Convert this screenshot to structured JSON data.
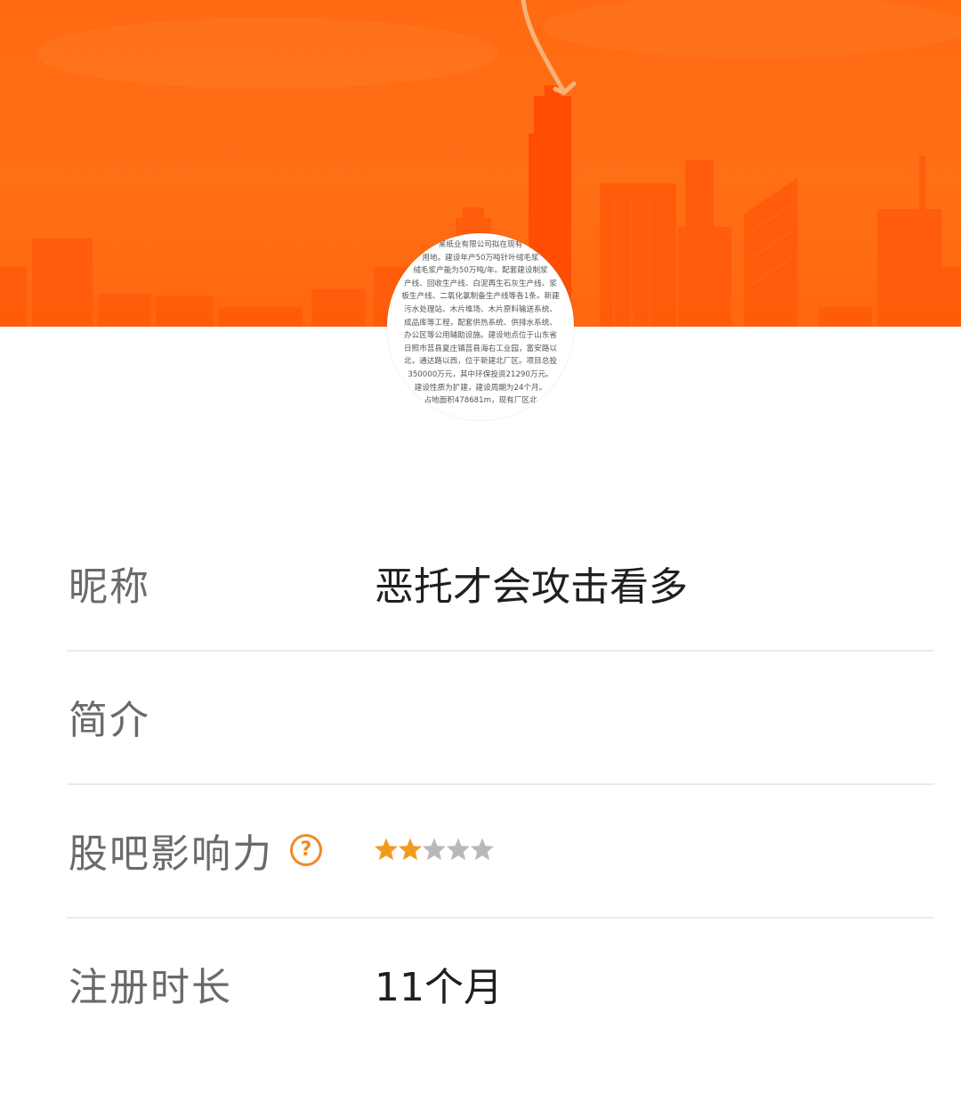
{
  "header": {
    "banner_color": "#ff6a12",
    "skyline_color": "#ff4f06"
  },
  "avatar": {
    "lines": [
      "某纸业有限公司拟在现有",
      "用地。建设年产50万吨针叶绒毛浆",
      "绒毛浆产能为50万吨/年。配套建设制浆",
      "产线、回收生产线、白泥再生石灰生产线、浆",
      "板生产线、二氧化氯制备生产线等各1条。新建",
      "污水处理站、木片堆场、木片原料输送系统、",
      "成品库等工程，配套供热系统、供排水系统、",
      "办公区等公用辅助设施。建设地点位于山东省",
      "日照市莒县夏庄镇莒县海右工业园，富安路以",
      "北，通达路以西，位于新建北厂区。项目总投",
      "350000万元，其中环保投资21290万元。",
      "建设性质为扩建，建设周期为24个月。",
      "占地面积478681m，现有厂区北"
    ]
  },
  "profile": {
    "nickname_label": "昵称",
    "nickname_value": "恶托才会攻击看多",
    "intro_label": "简介",
    "intro_value": "",
    "influence_label": "股吧影响力",
    "influence_help": "?",
    "influence_rating": 2,
    "influence_max": 5,
    "star_on_color": "#f39a1e",
    "star_off_color": "#b9b9b9",
    "register_label": "注册时长",
    "register_value": "11个月"
  }
}
